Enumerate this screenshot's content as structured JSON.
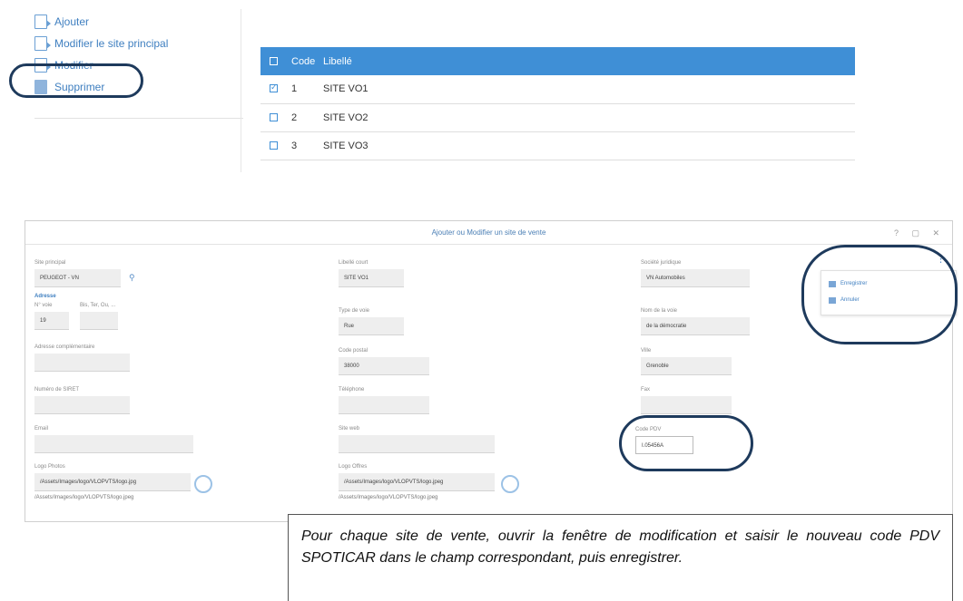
{
  "actions": {
    "add": "Ajouter",
    "edit_main_site": "Modifier le site principal",
    "edit": "Modifier",
    "delete": "Supprimer"
  },
  "sites_table": {
    "headers": {
      "code": "Code",
      "label": "Libellé"
    },
    "rows": [
      {
        "code": "1",
        "label": "SITE VO1",
        "checked": true
      },
      {
        "code": "2",
        "label": "SITE VO2",
        "checked": false
      },
      {
        "code": "3",
        "label": "SITE VO3",
        "checked": false
      }
    ]
  },
  "dialog": {
    "title": "Ajouter ou Modifier un site de vente",
    "window_controls": "? ▢ ✕",
    "fields": {
      "site_principal_label": "Site principal",
      "site_principal_value": "PEUGEOT - VN",
      "address_section": "Adresse",
      "street_no_label": "N° voie",
      "bis_ter_label": "Bis, Ter, Ou, ...",
      "street_no_value": "19",
      "address_extra_label": "Adresse complémentaire",
      "siret_label": "Numéro de SIRET",
      "email_label": "Email",
      "logo_photo_label": "Logo Photos",
      "logo_photo_path": "/Assets/Images/logo/VLOPVTS/logo.jpg",
      "logo_photo_alt": "/Assets/Images/logo/VLOPVTS/logo.jpeg",
      "site_label_label": "Libellé court",
      "site_label_value": "SITE VO1",
      "street_type_label": "Type de voie",
      "street_type_value": "Rue",
      "postal_code_label": "Code postal",
      "postal_code_value": "38000",
      "phone_label": "Téléphone",
      "website_label": "Site web",
      "logo_offers_label": "Logo Offres",
      "logo_offers_path": "/Assets/Images/logo/VLOPVTS/logo.jpeg",
      "logo_offers_alt": "/Assets/Images/logo/VLOPVTS/logo.jpeg",
      "legal_entity_label": "Société juridique",
      "legal_entity_value": "VN Automobiles",
      "street_name_label": "Nom de la voie",
      "street_name_value": "de la démocratie",
      "city_label": "Ville",
      "city_value": "Grenoble",
      "fax_label": "Fax",
      "pdv_code_label": "Code PDV",
      "pdv_code_value": "I.05456A"
    },
    "menu": {
      "save": "Enregistrer",
      "cancel": "Annuler"
    }
  },
  "note": "Pour chaque site de vente, ouvrir la fenêtre de modification et saisir le nouveau code PDV SPOTICAR dans le champ correspondant, puis enregistrer.",
  "colors": {
    "accent": "#3f8fd6",
    "highlight": "#1e3a5c"
  }
}
